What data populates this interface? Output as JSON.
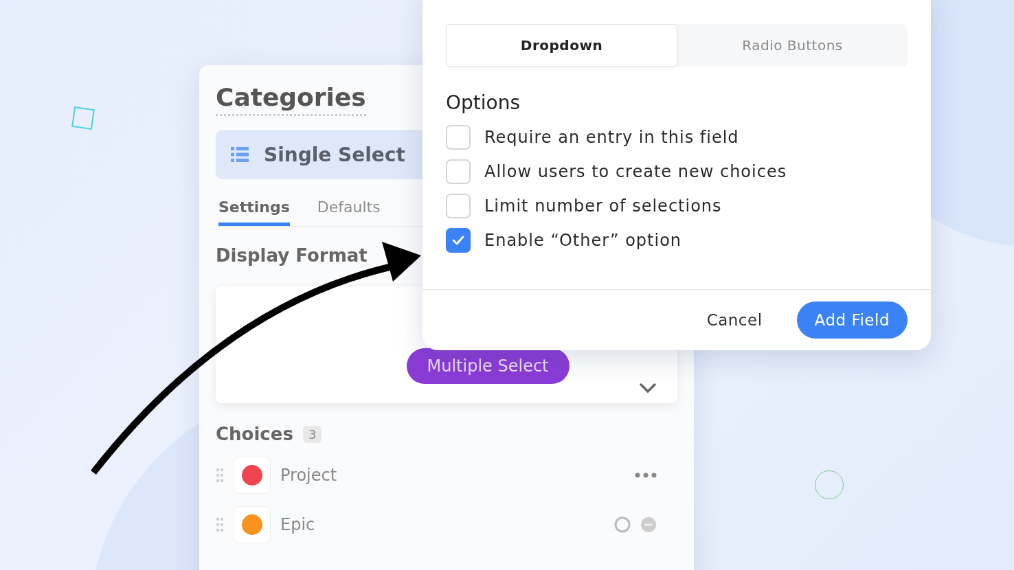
{
  "field_editor": {
    "title": "Categories",
    "field_type": "Single Select",
    "tabs": [
      {
        "label": "Settings",
        "selected": true
      },
      {
        "label": "Defaults",
        "selected": false
      }
    ],
    "display_format": {
      "heading": "Display Format",
      "value": "Multiple Select"
    },
    "choices": {
      "heading": "Choices",
      "count": "3",
      "items": [
        {
          "label": "Project",
          "color": "#f0454f"
        },
        {
          "label": "Epic",
          "color": "#f7931e"
        }
      ]
    }
  },
  "dialog": {
    "display_format": [
      {
        "label": "Dropdown",
        "selected": true
      },
      {
        "label": "Radio Buttons",
        "selected": false
      }
    ],
    "options_heading": "Options",
    "options": [
      {
        "label": "Require an entry in this field",
        "checked": false
      },
      {
        "label": "Allow users to create new choices",
        "checked": false
      },
      {
        "label": "Limit number of selections",
        "checked": false
      },
      {
        "label": "Enable “Other” option",
        "checked": true
      }
    ],
    "buttons": {
      "cancel": "Cancel",
      "confirm": "Add Field"
    }
  }
}
